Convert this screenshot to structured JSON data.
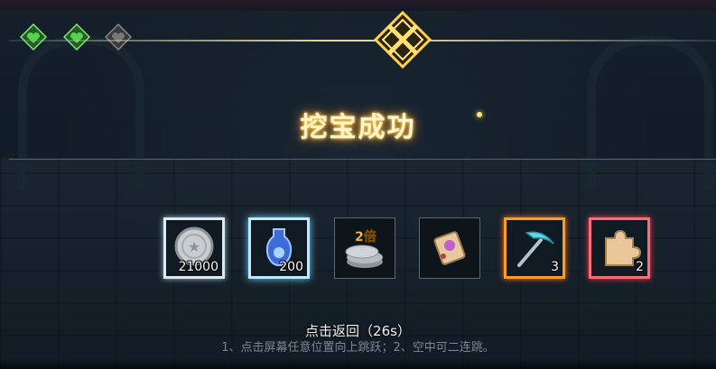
{
  "dialog": {
    "title": "挖宝成功",
    "return_text": "点击返回（26s）",
    "tip_text": "1、点击屏幕任意位置向上跳跃；2、空中可二连跳。"
  },
  "lives": [
    {
      "name": "heart-gem-icon",
      "state": "full",
      "color": "#3fae3a"
    },
    {
      "name": "heart-gem-icon",
      "state": "full",
      "color": "#3fae3a"
    },
    {
      "name": "heart-gem-icon",
      "state": "empty",
      "color": "#6b6b6b"
    }
  ],
  "rewards": [
    {
      "icon": "silver-coin-icon",
      "count": "21000",
      "rarity": "white"
    },
    {
      "icon": "blue-potion-icon",
      "count": "200",
      "rarity": "cyan"
    },
    {
      "icon": "double-coin-icon",
      "badge": "2倍",
      "count": "",
      "rarity": "plain"
    },
    {
      "icon": "scroll-icon",
      "count": "",
      "rarity": "plain"
    },
    {
      "icon": "pickaxe-icon",
      "count": "3",
      "rarity": "orange"
    },
    {
      "icon": "puzzle-piece-icon",
      "count": "2",
      "rarity": "red"
    }
  ],
  "colors": {
    "title_glow": "#ffcc44",
    "white_frame": "#dfe8ee",
    "cyan_frame": "#bfe9ff",
    "orange_frame": "#ff9b22",
    "red_frame": "#ff6a78"
  }
}
